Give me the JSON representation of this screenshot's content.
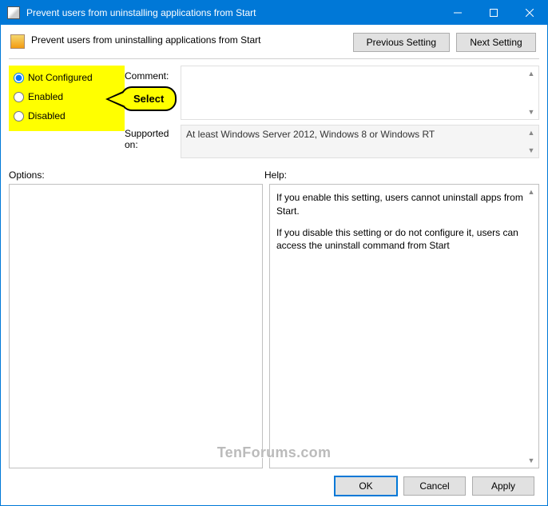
{
  "titlebar": {
    "title": "Prevent users from uninstalling applications from Start"
  },
  "header": {
    "title": "Prevent users from uninstalling applications from Start",
    "buttons": {
      "prev": "Previous Setting",
      "next": "Next Setting"
    }
  },
  "state": {
    "options": {
      "not_configured": "Not Configured",
      "enabled": "Enabled",
      "disabled": "Disabled"
    }
  },
  "labels": {
    "comment": "Comment:",
    "supported": "Supported on:",
    "options": "Options:",
    "help": "Help:"
  },
  "comment": "",
  "supported": "At least Windows Server 2012, Windows 8 or Windows RT",
  "help": {
    "p1": "If you enable this setting, users cannot uninstall apps from Start.",
    "p2": "If you disable this setting or do not configure it, users can access the uninstall command from Start"
  },
  "callout": {
    "text": "Select"
  },
  "footer": {
    "ok": "OK",
    "cancel": "Cancel",
    "apply": "Apply"
  },
  "watermark": "TenForums.com"
}
